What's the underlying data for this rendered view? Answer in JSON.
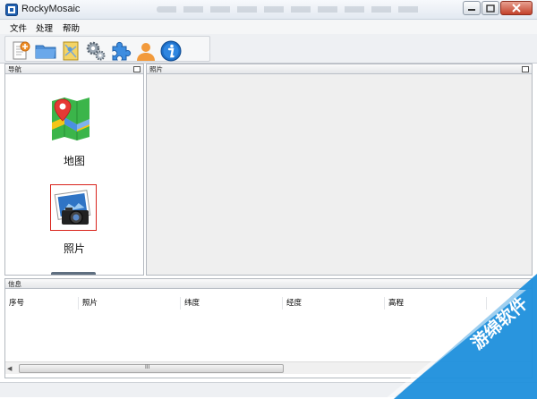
{
  "window": {
    "title": "RockyMosaic"
  },
  "menu": [
    "文件",
    "处理",
    "帮助"
  ],
  "toolbar": {
    "buttons": [
      {
        "name": "new-project-icon"
      },
      {
        "name": "open-folder-icon"
      },
      {
        "name": "map-file-icon"
      },
      {
        "name": "settings-gears-icon"
      },
      {
        "name": "plugin-puzzle-icon"
      },
      {
        "name": "user-icon"
      },
      {
        "name": "info-icon"
      }
    ]
  },
  "nav_panel": {
    "title": "导航",
    "items": [
      "地图",
      "照片"
    ]
  },
  "photo_panel": {
    "title": "照片"
  },
  "info_panel": {
    "title": "信息",
    "columns": [
      "序号",
      "照片",
      "纬度",
      "经度",
      "高程"
    ],
    "scroll_handle": "III"
  },
  "watermark": {
    "text": "游绵软件"
  },
  "colors": {
    "accent": "#1d8fdc",
    "selection_border": "#d9241c",
    "map_red": "#e53935",
    "map_green": "#3bb54a"
  }
}
